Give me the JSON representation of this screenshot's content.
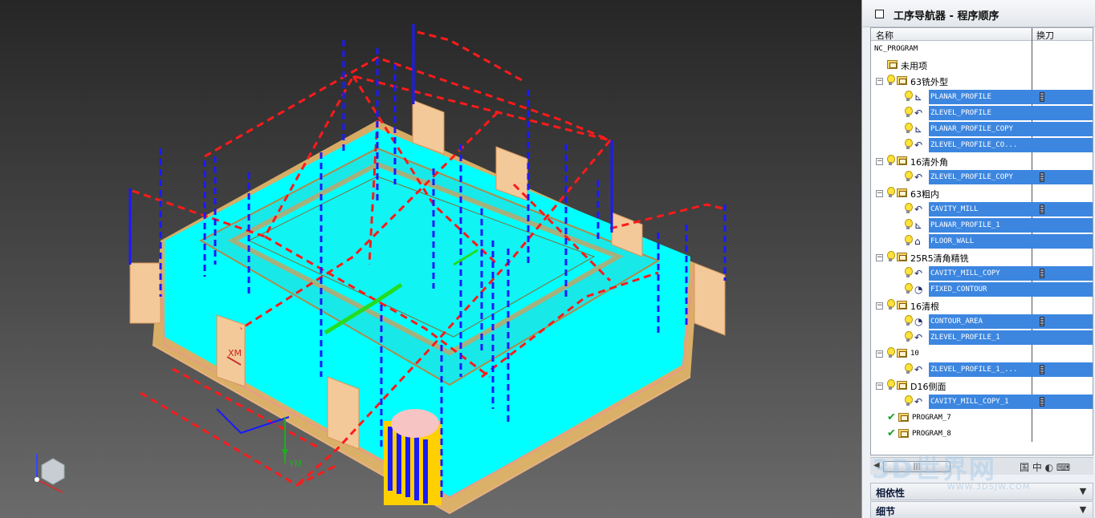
{
  "navigator": {
    "title": "工序导航器 - 程序顺序",
    "columns": {
      "name": "名称",
      "tool_change": "换刀"
    },
    "rows": [
      {
        "label": "NC_PROGRAM",
        "level": 0,
        "kind": "root"
      },
      {
        "label": "未用项",
        "level": 1,
        "kind": "group-unused"
      },
      {
        "label": "63铣外型",
        "level": 1,
        "kind": "group"
      },
      {
        "label": "PLANAR_PROFILE",
        "level": 2,
        "kind": "op-planar",
        "selected": true,
        "tool": true
      },
      {
        "label": "ZLEVEL_PROFILE",
        "level": 2,
        "kind": "op-zlevel",
        "selected": true,
        "tool": false
      },
      {
        "label": "PLANAR_PROFILE_COPY",
        "level": 2,
        "kind": "op-planar",
        "selected": true,
        "tool": false
      },
      {
        "label": "ZLEVEL_PROFILE_CO...",
        "level": 2,
        "kind": "op-zlevel",
        "selected": true,
        "tool": false
      },
      {
        "label": "16清外角",
        "level": 1,
        "kind": "group"
      },
      {
        "label": "ZLEVEL_PROFILE_COPY",
        "level": 2,
        "kind": "op-zlevel",
        "selected": true,
        "tool": true
      },
      {
        "label": "63粗内",
        "level": 1,
        "kind": "group"
      },
      {
        "label": "CAVITY_MILL",
        "level": 2,
        "kind": "op-cavity",
        "selected": true,
        "tool": true
      },
      {
        "label": "PLANAR_PROFILE_1",
        "level": 2,
        "kind": "op-planar",
        "selected": true,
        "tool": false
      },
      {
        "label": "FLOOR_WALL",
        "level": 2,
        "kind": "op-floor",
        "selected": true,
        "tool": false
      },
      {
        "label": "25R5清角精铣",
        "level": 1,
        "kind": "group"
      },
      {
        "label": "CAVITY_MILL_COPY",
        "level": 2,
        "kind": "op-cavity",
        "selected": true,
        "tool": true
      },
      {
        "label": "FIXED_CONTOUR",
        "level": 2,
        "kind": "op-contour",
        "selected": true,
        "tool": false
      },
      {
        "label": "16清根",
        "level": 1,
        "kind": "group"
      },
      {
        "label": "CONTOUR_AREA",
        "level": 2,
        "kind": "op-contour",
        "selected": true,
        "tool": true
      },
      {
        "label": "ZLEVEL_PROFILE_1",
        "level": 2,
        "kind": "op-zlevel",
        "selected": true,
        "tool": false
      },
      {
        "label": "10",
        "level": 1,
        "kind": "group"
      },
      {
        "label": "ZLEVEL_PROFILE_1_...",
        "level": 2,
        "kind": "op-zlevel",
        "selected": true,
        "tool": true
      },
      {
        "label": "D16侧面",
        "level": 1,
        "kind": "group"
      },
      {
        "label": "CAVITY_MILL_COPY_1",
        "level": 2,
        "kind": "op-cavity",
        "selected": true,
        "tool": true
      },
      {
        "label": "PROGRAM_7",
        "level": 1,
        "kind": "group-check"
      },
      {
        "label": "PROGRAM_8",
        "level": 1,
        "kind": "group-check"
      }
    ],
    "scroll_thumb_label": "|||",
    "panels": {
      "dependencies": "相依性",
      "details": "细节"
    }
  },
  "viewport": {
    "axis_labels": {
      "xm": "XM",
      "ym": "YM"
    }
  },
  "watermark": {
    "text": "3D世界网",
    "url": "WWW.3DSJW.COM"
  },
  "colors": {
    "selection": "#3c86e0",
    "model_cyan": "#00ffff",
    "toolpath_red": "#ff1a1a",
    "toolpath_blue": "#1a1aff"
  }
}
